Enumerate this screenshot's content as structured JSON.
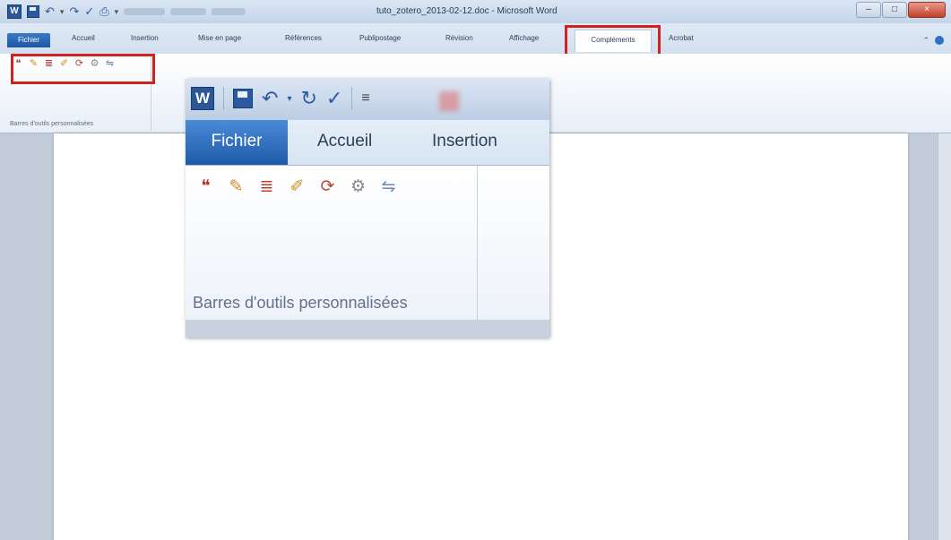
{
  "titlebar": {
    "title": "tuto_zotero_2013-02-12.doc - Microsoft Word",
    "word_letter": "W",
    "controls": [
      "–",
      "□",
      "×"
    ]
  },
  "tabs": {
    "items": [
      "Fichier",
      "Accueil",
      "Insertion",
      "Mise en page",
      "Références",
      "Publipostage",
      "Révision",
      "Affichage",
      "Compléments",
      "Acrobat"
    ],
    "active": "Compléments"
  },
  "ribbon": {
    "group_label": "Barres d'outils personnalisées",
    "icons": [
      "insert-citation-icon",
      "edit-citation-icon",
      "insert-bibliography-icon",
      "edit-bibliography-icon",
      "refresh-icon",
      "document-preferences-icon",
      "unlink-citations-icon"
    ]
  },
  "inset": {
    "word_letter": "W",
    "tabs": [
      "Fichier",
      "Accueil",
      "Insertion"
    ],
    "group_label": "Barres d'outils personnalisées"
  },
  "colors": {
    "highlight": "#d0231f",
    "file_tab": "#1e57a6",
    "word_blue": "#2b5797"
  }
}
